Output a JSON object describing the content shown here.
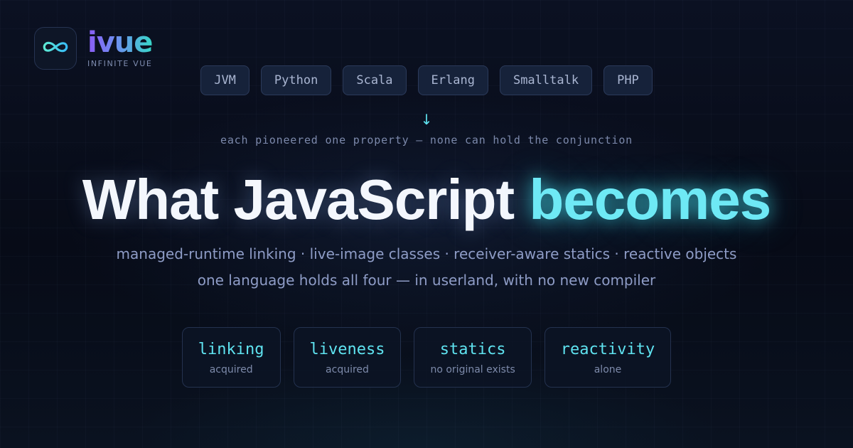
{
  "brand": {
    "name": "ivue",
    "tagline": "INFINITE VUE",
    "icon": "infinity-icon",
    "colors": {
      "gradient_start": "#8b5cf6",
      "gradient_end": "#38d6c8"
    }
  },
  "languages": [
    "JVM",
    "Python",
    "Scala",
    "Erlang",
    "Smalltalk",
    "PHP"
  ],
  "arrow": "↓",
  "caption": "each pioneered one property — none can hold the conjunction",
  "headline": {
    "main": "What JavaScript",
    "accent": "becomes"
  },
  "subtitle": {
    "line1": "managed-runtime linking · live-image classes · receiver-aware statics · reactive objects",
    "line2": "one language holds all four — in userland, with no new compiler"
  },
  "properties": [
    {
      "name": "linking",
      "status": "acquired"
    },
    {
      "name": "liveness",
      "status": "acquired"
    },
    {
      "name": "statics",
      "status": "no original exists"
    },
    {
      "name": "reactivity",
      "status": "alone"
    }
  ],
  "colors": {
    "background": "#080d1a",
    "accent": "#6ee9f5",
    "text_primary": "#f4f7fd",
    "text_muted": "#8e9cc6"
  }
}
